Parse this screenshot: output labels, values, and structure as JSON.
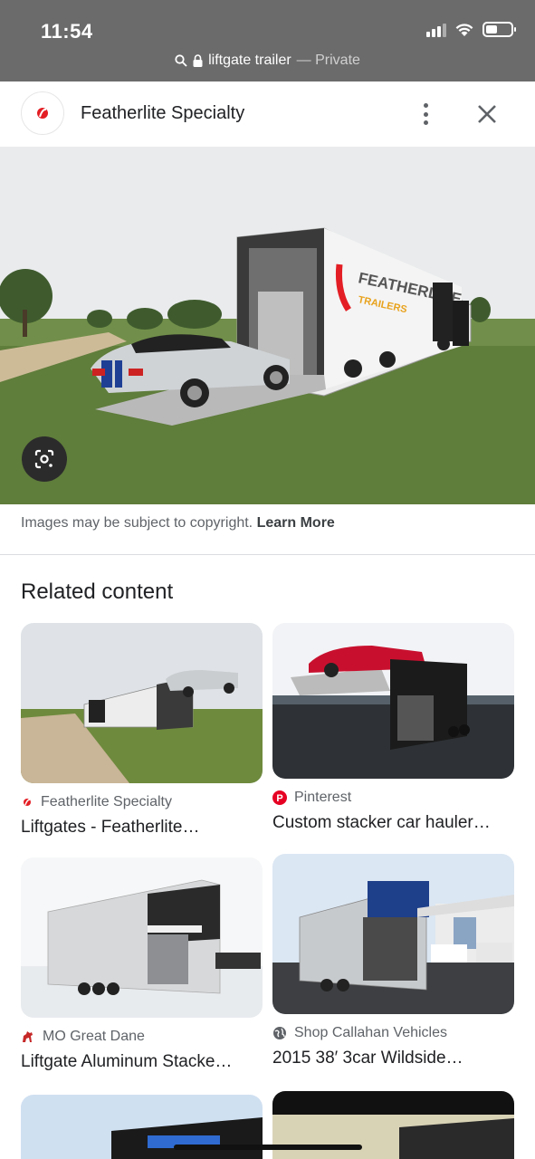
{
  "status_bar": {
    "time": "11:54"
  },
  "url_bar": {
    "query": "liftgate trailer",
    "mode": " — Private"
  },
  "header": {
    "title": "Featherlite Specialty"
  },
  "hero": {
    "brand_text": "FEATHERLITE",
    "brand_sub": "TRAILERS"
  },
  "copyright": {
    "text": "Images may be subject to copyright.",
    "link": "Learn More"
  },
  "related": {
    "heading": "Related content",
    "items": [
      {
        "source": "Featherlite Specialty",
        "caption": "Liftgates - Featherlite…",
        "icon": "featherlite-logo"
      },
      {
        "source": "Pinterest",
        "caption": "Custom stacker car hauler…",
        "icon": "pinterest-logo"
      },
      {
        "source": "MO Great Dane",
        "caption": "Liftgate Aluminum Stacke…",
        "icon": "great-dane-logo"
      },
      {
        "source": "Shop Callahan Vehicles",
        "caption": "2015 38′ 3car Wildside…",
        "icon": "globe-icon"
      }
    ]
  },
  "colors": {
    "status_bg": "#6b6b6b",
    "accent_red": "#e31e24",
    "pinterest": "#e60023"
  }
}
